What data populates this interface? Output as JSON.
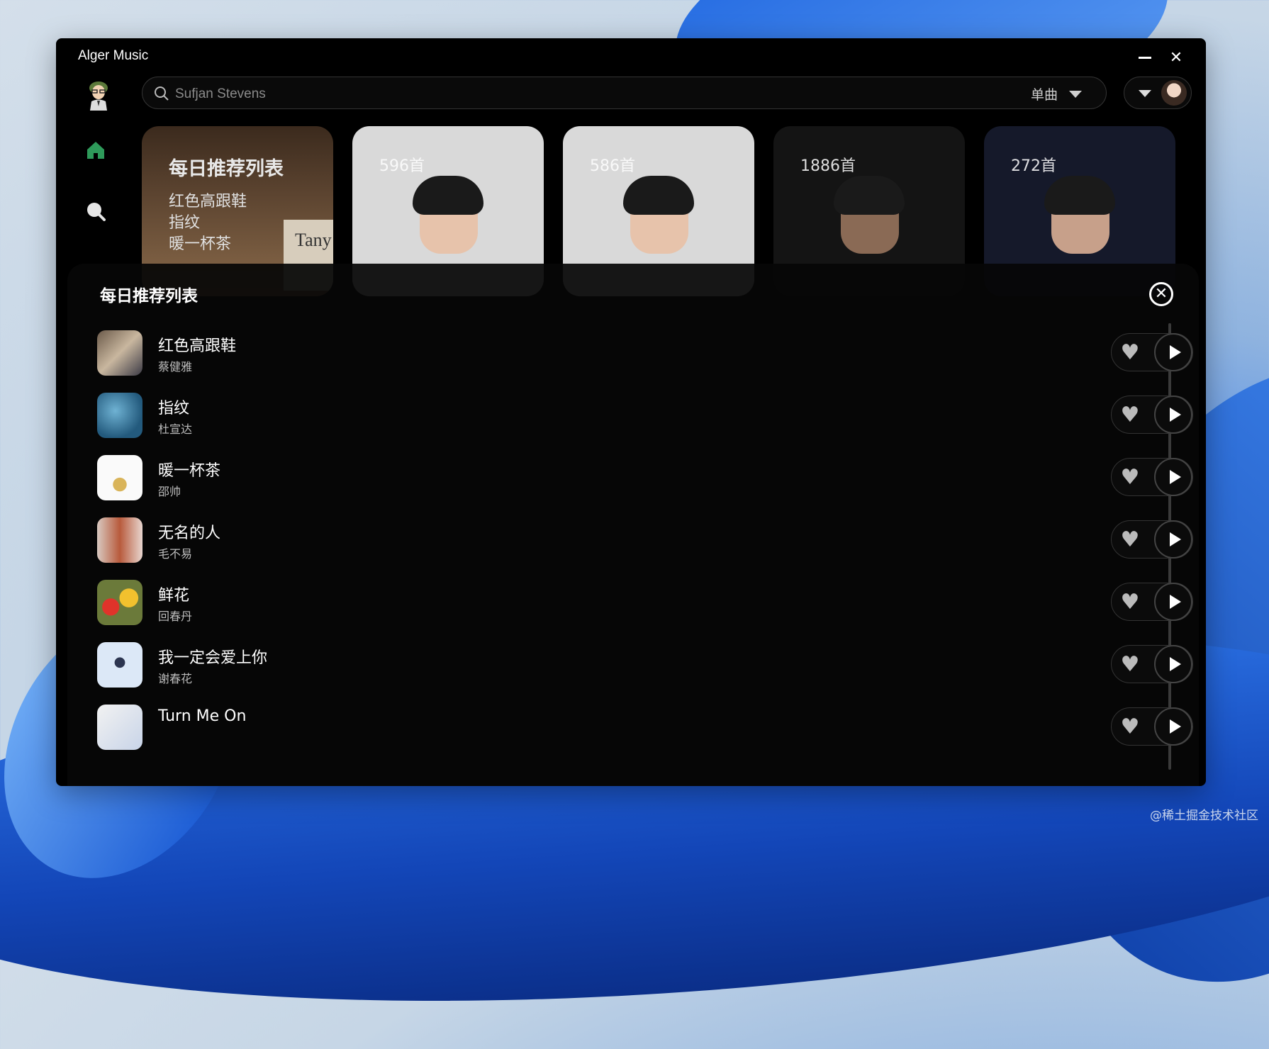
{
  "window": {
    "title": "Alger Music"
  },
  "search": {
    "placeholder": "Sufjan Stevens",
    "type_label": "单曲"
  },
  "cards": [
    {
      "title": "每日推荐列表",
      "lines": [
        "红色高跟鞋",
        "指纹",
        "暖一杯茶"
      ],
      "poster_text": "Tany"
    },
    {
      "count": "596首"
    },
    {
      "count": "586首"
    },
    {
      "count": "1886首"
    },
    {
      "count": "272首"
    }
  ],
  "panel": {
    "title": "每日推荐列表",
    "songs": [
      {
        "name": "红色高跟鞋",
        "artist": "蔡健雅"
      },
      {
        "name": "指纹",
        "artist": "杜宣达"
      },
      {
        "name": "暖一杯茶",
        "artist": "邵帅"
      },
      {
        "name": "无名的人",
        "artist": "毛不易"
      },
      {
        "name": "鲜花",
        "artist": "回春丹"
      },
      {
        "name": "我一定会爱上你",
        "artist": "谢春花"
      },
      {
        "name": "Turn Me On",
        "artist": ""
      }
    ]
  },
  "icons": {
    "like": "heart-icon",
    "play": "play-icon",
    "close": "close-icon",
    "home": "home-icon",
    "search": "search-icon"
  },
  "colors": {
    "accent": "#2e9a5a",
    "background": "#000000"
  },
  "watermark": "@稀土掘金技术社区"
}
